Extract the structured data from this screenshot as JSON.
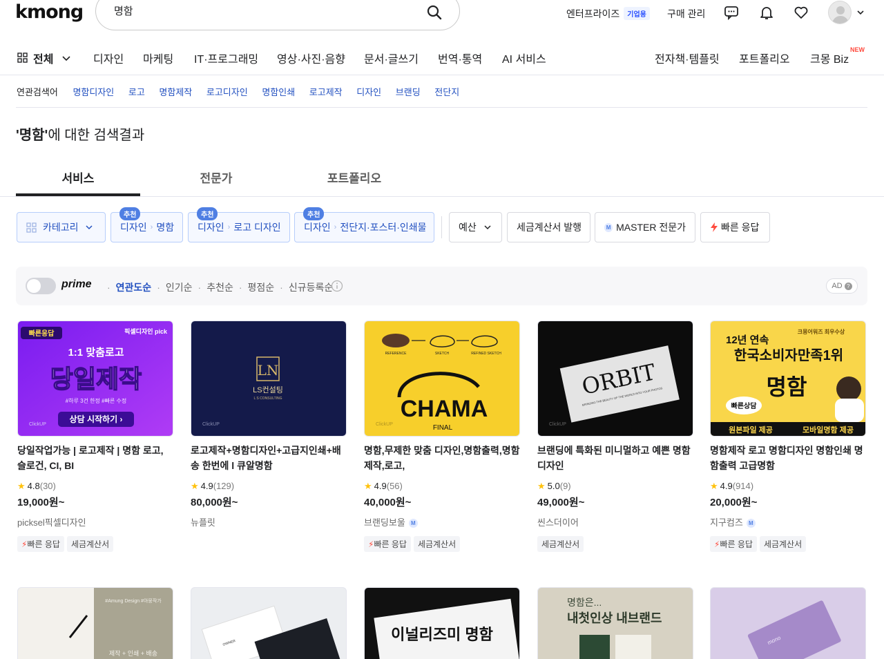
{
  "header": {
    "logo": "kmong",
    "search_value": "명함",
    "enterprise": "엔터프라이즈",
    "enterprise_badge": "기업용",
    "purchase": "구매 관리"
  },
  "nav": {
    "all": "전체",
    "items": [
      "디자인",
      "마케팅",
      "IT·프로그래밍",
      "영상·사진·음향",
      "문서·글쓰기",
      "번역·통역",
      "AI 서비스"
    ],
    "right": [
      "전자책·템플릿",
      "포트폴리오",
      "크몽 Biz"
    ],
    "new_badge": "NEW"
  },
  "related": {
    "label": "연관검색어",
    "keywords": [
      "명함디자인",
      "로고",
      "명함제작",
      "로고디자인",
      "명함인쇄",
      "로고제작",
      "디자인",
      "브랜딩",
      "전단지"
    ]
  },
  "result": {
    "keyword": "'명함'",
    "suffix": "에 대한 검색결과"
  },
  "tabs": [
    "서비스",
    "전문가",
    "포트폴리오"
  ],
  "filters": {
    "category": "카테고리",
    "rec_label": "추천",
    "rec_chips": [
      {
        "a": "디자인",
        "b": "명함"
      },
      {
        "a": "디자인",
        "b": "로고 디자인"
      },
      {
        "a": "디자인",
        "b": "전단지·포스터·인쇄물"
      }
    ],
    "budget": "예산",
    "tax": "세금계산서 발행",
    "master": "MASTER 전문가",
    "fast": "빠른 응답"
  },
  "sortbar": {
    "prime": "prime",
    "sorts": [
      "연관도순",
      "인기순",
      "추천순",
      "평점순",
      "신규등록순"
    ],
    "ad": "AD"
  },
  "cards": [
    {
      "title": "당일작업가능 | 로고제작 | 명함 로고, 슬로건, CI, BI",
      "rating": "4.8",
      "count": "(30)",
      "price": "19,000원~",
      "seller": "picksel픽셀디자인",
      "master": false,
      "tags": [
        "빠른 응답",
        "세금계산서"
      ],
      "thumb": {
        "badge": "빠른응답",
        "brand": "픽셀디자인 pick",
        "line1": "1:1 맞춤로고",
        "big": "당일제작",
        "sub": "#하루 3건 한정  #빠른 수정",
        "cta": "상담 시작하기 ›",
        "clickup": "ClickUP"
      }
    },
    {
      "title": "로고제작+명함디자인+고급지인쇄+배송 한번에 l 큐알명함",
      "rating": "4.9",
      "count": "(129)",
      "price": "80,000원~",
      "seller": "뉴플릿",
      "master": false,
      "tags": [],
      "thumb": {
        "mono": "LN",
        "name": "LS컨설팅",
        "sub": "L S CONSULTING",
        "clickup": "ClickUP"
      }
    },
    {
      "title": "명함,무제한 맞춤 디자인,명함출력,명함제작,로고,",
      "rating": "4.9",
      "count": "(56)",
      "price": "40,000원~",
      "seller": "브랜딩보울",
      "master": true,
      "tags": [
        "빠른 응답",
        "세금계산서"
      ],
      "thumb": {
        "word": "CHAMA",
        "final": "FINAL",
        "s1": "REFERENCE",
        "s2": "SKETCH",
        "s3": "REFINED SKETCH",
        "clickup": "ClickUP"
      }
    },
    {
      "title": "브랜딩에 특화된 미니멀하고 예쁜 명함 디자인",
      "rating": "5.0",
      "count": "(9)",
      "price": "49,000원~",
      "seller": "씬스더이어",
      "master": false,
      "tags": [
        "세금계산서"
      ],
      "thumb": {
        "word": "ORBIT",
        "small": "BRINGING THE BEAUTY OF THE WORLD INTO YOUR PHOTOS",
        "clickup": "ClickUP"
      }
    },
    {
      "title": "명함제작 로고 명함디자인 명함인쇄 명함출력 고급명함",
      "rating": "4.9",
      "count": "(914)",
      "price": "20,000원~",
      "seller": "지구컴즈",
      "master": true,
      "tags": [
        "빠른 응답",
        "세금계산서"
      ],
      "thumb": {
        "line1": "12년 연속",
        "award": "크몽어워즈 최우수상",
        "line2": "한국소비자만족1위",
        "big": "명함",
        "bubble": "빠른상담",
        "bar1": "원본파일 제공",
        "bar2": "모바일명함 제공"
      }
    }
  ],
  "row2": [
    {
      "text": "#Amung Design #아뭉작가",
      "sub": "제작 + 인쇄 + 배송"
    },
    {
      "text": "OWNER"
    },
    {
      "text": "이널리즈미 명함"
    },
    {
      "t1": "명함은...",
      "t2": "내첫인상 내브랜드"
    },
    {
      "text": "mono"
    }
  ],
  "colors": {
    "accent": "#2250c0",
    "star": "#ffc20e",
    "bolt": "#ff4b3e"
  }
}
